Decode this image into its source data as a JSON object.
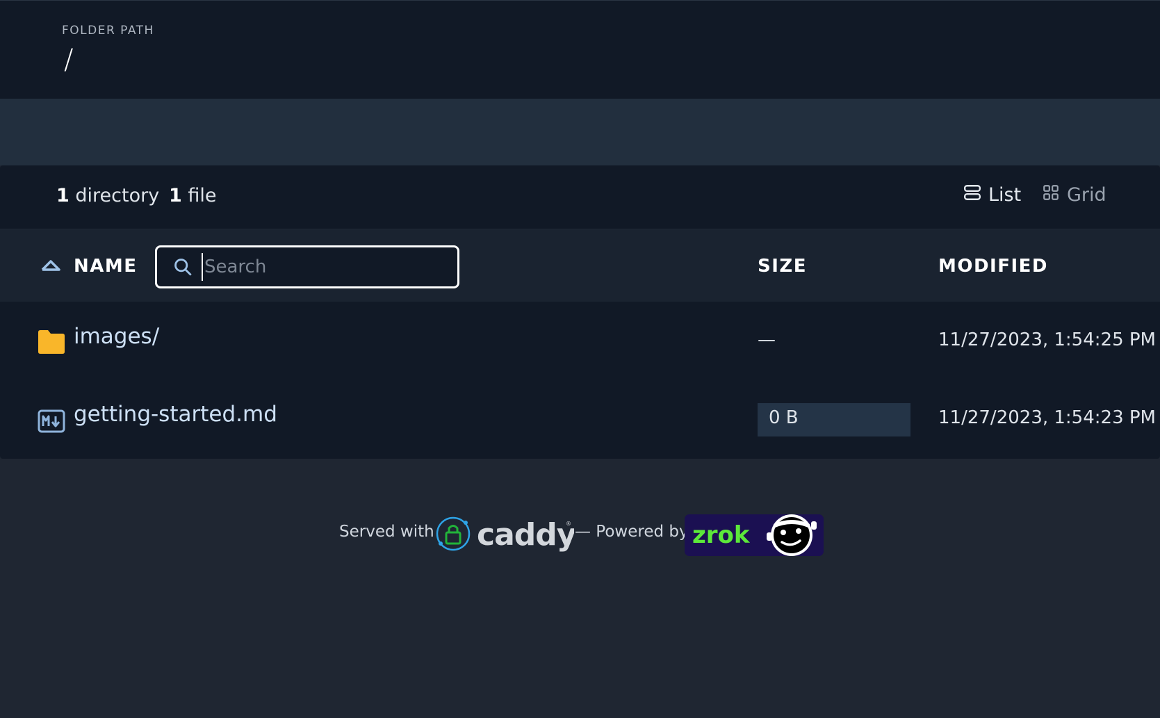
{
  "header": {
    "label": "FOLDER PATH",
    "path": "/"
  },
  "summary": {
    "directories_count": "1",
    "directories_label": "directory",
    "files_count": "1",
    "files_label": "file"
  },
  "view_toggle": {
    "list_label": "List",
    "grid_label": "Grid"
  },
  "table": {
    "columns": {
      "name": "NAME",
      "size": "SIZE",
      "modified": "MODIFIED"
    },
    "search": {
      "placeholder": "Search",
      "value": ""
    },
    "rows": [
      {
        "name": "images/",
        "icon": "folder-icon",
        "size": "—",
        "modified": "11/27/2023, 1:54:25 PM"
      },
      {
        "name": "getting-started.md",
        "icon": "markdown-file-icon",
        "size": "0 B",
        "modified": "11/27/2023, 1:54:23 PM"
      }
    ]
  },
  "footer": {
    "served_with": "Served with",
    "caddy_text": "caddy",
    "powered_by": "— Powered by",
    "zrok_text": "zrok"
  },
  "colors": {
    "header_bg": "#111926",
    "page_bg": "#1f2632",
    "band_bg": "#222f3e",
    "link": "#cde0f5",
    "folder": "#f9b62a",
    "caddy_accent": "#2ea3e6",
    "caddy_lock": "#22b33a",
    "zrok_green": "#5ce83a",
    "zrok_bg": "#1b1052"
  }
}
